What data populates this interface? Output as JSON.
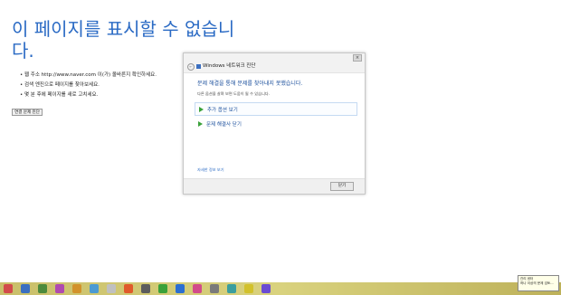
{
  "error_page": {
    "title": "이 페이지를 표시할 수 없습니다.",
    "tips": [
      "웹 주소 http://www.naver.com 이(가) 올바른지 확인하세요.",
      "검색 엔진으로 페이지를 찾아보세요.",
      "몇 분 후에 페이지를 새로 고치세요."
    ],
    "diagnose_button": "연결 문제 진단"
  },
  "dialog": {
    "close_glyph": "×",
    "back_glyph": "←",
    "title": "Windows 네트워크 진단",
    "headline": "문제 해결을 통해 문제를 찾아내지 못했습니다.",
    "subtext": "다른 옵션을 살펴 보면 도움이 될 수 있습니다.",
    "options": [
      "추가 옵션 보기",
      "문제 해결사 닫기"
    ],
    "more_info_link": "자세한 정보 보기",
    "close_button": "닫기"
  },
  "taskbar": {
    "icon_colors": [
      "#d24b4b",
      "#3b6fc0",
      "#4c8a3c",
      "#b04ab0",
      "#d2922b",
      "#4b9ad2",
      "#c0c0c0",
      "#e05a2b",
      "#5c5c5c",
      "#3aa13a",
      "#2b6fd2",
      "#d24b8a",
      "#7a7a7a",
      "#3b9e9e",
      "#d2c12b",
      "#6a4bd2"
    ],
    "tooltip": [
      "관리 센터",
      "하나 이상의 문제 검토..."
    ]
  }
}
